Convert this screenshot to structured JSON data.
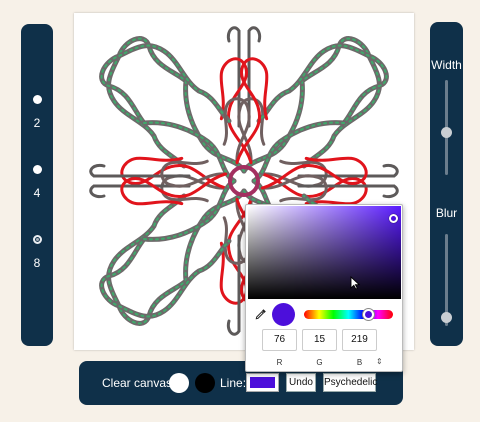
{
  "symmetry": {
    "options": [
      {
        "label": "2",
        "selected": false
      },
      {
        "label": "4",
        "selected": false
      },
      {
        "label": "8",
        "selected": true
      }
    ]
  },
  "width_slider": {
    "label": "Width",
    "value": 0.45
  },
  "blur_slider": {
    "label": "Blur",
    "value": 0.1
  },
  "bottom_bar": {
    "clear_label": "Clear canvas:",
    "clear_white_color": "#ffffff",
    "clear_black_color": "#000000",
    "line_label": "Line:",
    "line_color": "#4c0fdb",
    "undo_label": "Undo",
    "psychedelic_label": "Psychedelic"
  },
  "color_picker": {
    "hue_color": "#5a1bff",
    "current_color": "#4c0fdb",
    "r": "76",
    "g": "15",
    "b": "219",
    "r_label": "R",
    "g_label": "G",
    "b_label": "B",
    "mode_toggle": "⇕",
    "hue_value": 0.72
  },
  "icons": {
    "eyedropper": "eyedropper-icon",
    "cursor": "mouse-cursor-icon"
  }
}
